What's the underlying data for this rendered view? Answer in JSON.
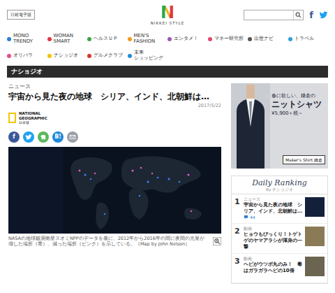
{
  "header": {
    "edition_button": "日経電子版",
    "logo_mark": "N",
    "logo_text": "NIKKEI STYLE",
    "search": {
      "placeholder": ""
    },
    "social": [
      {
        "kind": "facebook",
        "label": "f"
      },
      {
        "kind": "twitter"
      }
    ]
  },
  "nav": [
    {
      "label": "MONO\nTRENDY",
      "color": "#2a7fd4"
    },
    {
      "label": "WOMAN\nSMART",
      "color": "#e0383e"
    },
    {
      "label": "ヘルスＵＰ",
      "color": "#3aa34a"
    },
    {
      "label": "MEN'S\nFASHION",
      "color": "#f19a1a"
    },
    {
      "label": "エンタメ！",
      "color": "#9b59b6"
    },
    {
      "label": "マネー研究所",
      "color": "#e4476b"
    },
    {
      "label": "出世ナビ",
      "color": "#555555"
    },
    {
      "label": "トラベル",
      "color": "#2a9fd6"
    },
    {
      "label": "オリパラ",
      "color": "#e84a8a"
    },
    {
      "label": "ナショジオ",
      "color": "#f2c300"
    },
    {
      "label": "グルメクラブ",
      "color": "#d9342b"
    },
    {
      "label": "未来\nショッピング",
      "color": "#1f8fd6"
    }
  ],
  "section_bar": "ナショジオ",
  "article": {
    "category": "ニュース",
    "title": "宇宙から見た夜の地球　シリア、インド、北朝鮮は…",
    "date": "2017/5/22",
    "publisher": {
      "name": "NATIONAL\nGEOGRAPHIC",
      "edition": "日本版"
    },
    "share": [
      {
        "kind": "facebook",
        "label": "f",
        "color": "#3b5998"
      },
      {
        "kind": "twitter",
        "color": "#1da1f2"
      },
      {
        "kind": "evernote",
        "color": "#5cb85c"
      },
      {
        "kind": "hatena",
        "label": "B!",
        "color": "#1e88d9"
      },
      {
        "kind": "mail",
        "color": "#9aa0a6"
      }
    ],
    "caption": "NASAの地球観測衛星スオミNPPのデータを基に、2012年から2016年の間に夜間の光量が増した場所（青）、減った場所（ピンク）を示している。（Map by John Nelson）"
  },
  "ad": {
    "lines": [
      "春に欲しい、鎌倉の",
      "ニットシャツ",
      "¥5,900＋税～"
    ],
    "brand": "Maker's Shirt 鎌倉"
  },
  "ranking": {
    "title": "Daily Ranking",
    "by": "By ナショジオ",
    "items": [
      {
        "rank": "1",
        "category": "ニュース",
        "title": "宇宙から見た夜の地球　シリア、インド、北朝鮮は…",
        "comments": "44"
      },
      {
        "rank": "2",
        "category": "動画",
        "title": "ヒョウもびっくり！トゲトゲのヤマアラシが渾身の一撃"
      },
      {
        "rank": "3",
        "category": "動画",
        "title": "ヘビがウツボ丸のみ！　毒はガラガラヘビの10倍"
      }
    ]
  }
}
